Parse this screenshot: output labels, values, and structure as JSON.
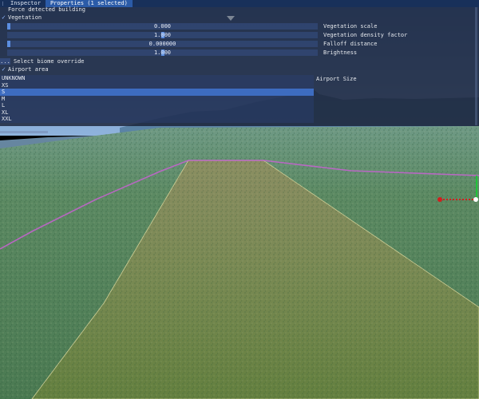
{
  "tabs": [
    {
      "label": "Inspector"
    },
    {
      "label": "Properties (1 selected)"
    }
  ],
  "panel": {
    "force_building_label": "Force detected building",
    "vegetation_label": "Vegetation",
    "vegetation_checked": true,
    "sliders": [
      {
        "value": "0.000",
        "label": "Vegetation scale",
        "fraction": 0.0
      },
      {
        "value": "1.000",
        "label": "Vegetation density factor",
        "fraction": 0.5
      },
      {
        "value": "0.000000",
        "label": "Falloff distance",
        "fraction": 0.0
      },
      {
        "value": "1.000",
        "label": "Brightness",
        "fraction": 0.5
      }
    ],
    "biome_button": "...",
    "biome_label": "Select biome override",
    "airport_label": "Airport area",
    "airport_checked": true,
    "airport_size_label": "Airport Size",
    "airport_sizes": [
      "UNKNOWN",
      "XS",
      "S",
      "M",
      "L",
      "XL",
      "XXL"
    ],
    "airport_size_selected": "S"
  },
  "colors": {
    "tab_active": "#2b5ba8",
    "selection": "#3d6cc0",
    "boundary_line": "#c862d2",
    "gizmo_red": "#d21e1e",
    "gizmo_green": "#21c43a"
  },
  "icons": {
    "check": "checkmark-icon",
    "gizmo": "transform-gizmo-icon"
  }
}
